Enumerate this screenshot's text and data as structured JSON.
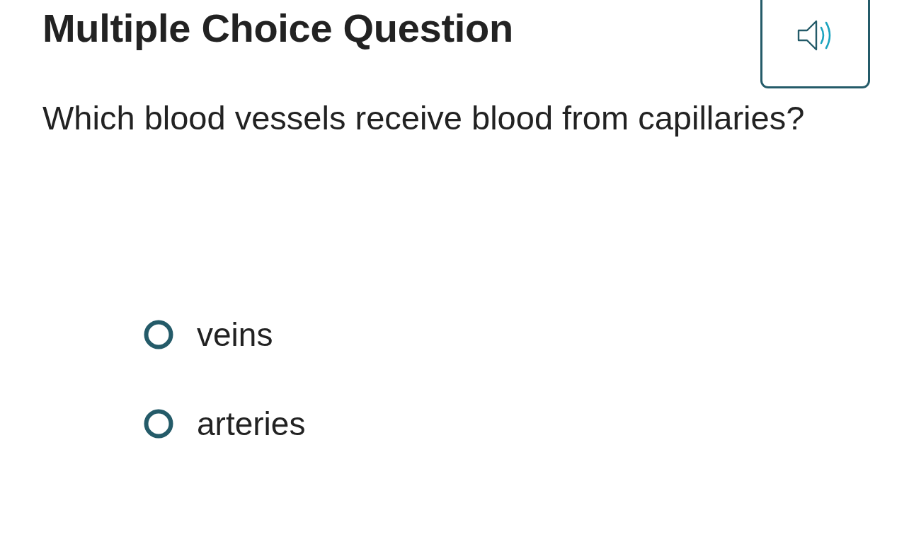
{
  "title": "Multiple Choice Question",
  "question": "Which blood vessels receive blood from capillaries?",
  "options": [
    {
      "label": "veins",
      "selected": false
    },
    {
      "label": "arteries",
      "selected": false
    }
  ]
}
